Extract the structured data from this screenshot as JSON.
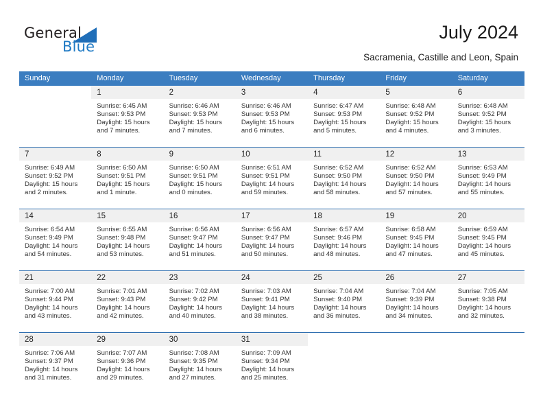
{
  "brand": {
    "name_part1": "General",
    "name_part2": "Blue",
    "accent_color": "#1f7ac4",
    "logo_icon": "triangle-flag-icon"
  },
  "header": {
    "title": "July 2024",
    "subtitle": "Sacramenia, Castille and Leon, Spain"
  },
  "calendar": {
    "header_bg": "#3b7dc0",
    "date_band_bg": "#f0f0f0",
    "row_border_color": "#2f6fb0",
    "weekdays": [
      "Sunday",
      "Monday",
      "Tuesday",
      "Wednesday",
      "Thursday",
      "Friday",
      "Saturday"
    ],
    "weeks": [
      [
        {
          "day": "",
          "lines": []
        },
        {
          "day": "1",
          "lines": [
            "Sunrise: 6:45 AM",
            "Sunset: 9:53 PM",
            "Daylight: 15 hours",
            "and 7 minutes."
          ]
        },
        {
          "day": "2",
          "lines": [
            "Sunrise: 6:46 AM",
            "Sunset: 9:53 PM",
            "Daylight: 15 hours",
            "and 7 minutes."
          ]
        },
        {
          "day": "3",
          "lines": [
            "Sunrise: 6:46 AM",
            "Sunset: 9:53 PM",
            "Daylight: 15 hours",
            "and 6 minutes."
          ]
        },
        {
          "day": "4",
          "lines": [
            "Sunrise: 6:47 AM",
            "Sunset: 9:53 PM",
            "Daylight: 15 hours",
            "and 5 minutes."
          ]
        },
        {
          "day": "5",
          "lines": [
            "Sunrise: 6:48 AM",
            "Sunset: 9:52 PM",
            "Daylight: 15 hours",
            "and 4 minutes."
          ]
        },
        {
          "day": "6",
          "lines": [
            "Sunrise: 6:48 AM",
            "Sunset: 9:52 PM",
            "Daylight: 15 hours",
            "and 3 minutes."
          ]
        }
      ],
      [
        {
          "day": "7",
          "lines": [
            "Sunrise: 6:49 AM",
            "Sunset: 9:52 PM",
            "Daylight: 15 hours",
            "and 2 minutes."
          ]
        },
        {
          "day": "8",
          "lines": [
            "Sunrise: 6:50 AM",
            "Sunset: 9:51 PM",
            "Daylight: 15 hours",
            "and 1 minute."
          ]
        },
        {
          "day": "9",
          "lines": [
            "Sunrise: 6:50 AM",
            "Sunset: 9:51 PM",
            "Daylight: 15 hours",
            "and 0 minutes."
          ]
        },
        {
          "day": "10",
          "lines": [
            "Sunrise: 6:51 AM",
            "Sunset: 9:51 PM",
            "Daylight: 14 hours",
            "and 59 minutes."
          ]
        },
        {
          "day": "11",
          "lines": [
            "Sunrise: 6:52 AM",
            "Sunset: 9:50 PM",
            "Daylight: 14 hours",
            "and 58 minutes."
          ]
        },
        {
          "day": "12",
          "lines": [
            "Sunrise: 6:52 AM",
            "Sunset: 9:50 PM",
            "Daylight: 14 hours",
            "and 57 minutes."
          ]
        },
        {
          "day": "13",
          "lines": [
            "Sunrise: 6:53 AM",
            "Sunset: 9:49 PM",
            "Daylight: 14 hours",
            "and 55 minutes."
          ]
        }
      ],
      [
        {
          "day": "14",
          "lines": [
            "Sunrise: 6:54 AM",
            "Sunset: 9:49 PM",
            "Daylight: 14 hours",
            "and 54 minutes."
          ]
        },
        {
          "day": "15",
          "lines": [
            "Sunrise: 6:55 AM",
            "Sunset: 9:48 PM",
            "Daylight: 14 hours",
            "and 53 minutes."
          ]
        },
        {
          "day": "16",
          "lines": [
            "Sunrise: 6:56 AM",
            "Sunset: 9:47 PM",
            "Daylight: 14 hours",
            "and 51 minutes."
          ]
        },
        {
          "day": "17",
          "lines": [
            "Sunrise: 6:56 AM",
            "Sunset: 9:47 PM",
            "Daylight: 14 hours",
            "and 50 minutes."
          ]
        },
        {
          "day": "18",
          "lines": [
            "Sunrise: 6:57 AM",
            "Sunset: 9:46 PM",
            "Daylight: 14 hours",
            "and 48 minutes."
          ]
        },
        {
          "day": "19",
          "lines": [
            "Sunrise: 6:58 AM",
            "Sunset: 9:45 PM",
            "Daylight: 14 hours",
            "and 47 minutes."
          ]
        },
        {
          "day": "20",
          "lines": [
            "Sunrise: 6:59 AM",
            "Sunset: 9:45 PM",
            "Daylight: 14 hours",
            "and 45 minutes."
          ]
        }
      ],
      [
        {
          "day": "21",
          "lines": [
            "Sunrise: 7:00 AM",
            "Sunset: 9:44 PM",
            "Daylight: 14 hours",
            "and 43 minutes."
          ]
        },
        {
          "day": "22",
          "lines": [
            "Sunrise: 7:01 AM",
            "Sunset: 9:43 PM",
            "Daylight: 14 hours",
            "and 42 minutes."
          ]
        },
        {
          "day": "23",
          "lines": [
            "Sunrise: 7:02 AM",
            "Sunset: 9:42 PM",
            "Daylight: 14 hours",
            "and 40 minutes."
          ]
        },
        {
          "day": "24",
          "lines": [
            "Sunrise: 7:03 AM",
            "Sunset: 9:41 PM",
            "Daylight: 14 hours",
            "and 38 minutes."
          ]
        },
        {
          "day": "25",
          "lines": [
            "Sunrise: 7:04 AM",
            "Sunset: 9:40 PM",
            "Daylight: 14 hours",
            "and 36 minutes."
          ]
        },
        {
          "day": "26",
          "lines": [
            "Sunrise: 7:04 AM",
            "Sunset: 9:39 PM",
            "Daylight: 14 hours",
            "and 34 minutes."
          ]
        },
        {
          "day": "27",
          "lines": [
            "Sunrise: 7:05 AM",
            "Sunset: 9:38 PM",
            "Daylight: 14 hours",
            "and 32 minutes."
          ]
        }
      ],
      [
        {
          "day": "28",
          "lines": [
            "Sunrise: 7:06 AM",
            "Sunset: 9:37 PM",
            "Daylight: 14 hours",
            "and 31 minutes."
          ]
        },
        {
          "day": "29",
          "lines": [
            "Sunrise: 7:07 AM",
            "Sunset: 9:36 PM",
            "Daylight: 14 hours",
            "and 29 minutes."
          ]
        },
        {
          "day": "30",
          "lines": [
            "Sunrise: 7:08 AM",
            "Sunset: 9:35 PM",
            "Daylight: 14 hours",
            "and 27 minutes."
          ]
        },
        {
          "day": "31",
          "lines": [
            "Sunrise: 7:09 AM",
            "Sunset: 9:34 PM",
            "Daylight: 14 hours",
            "and 25 minutes."
          ]
        },
        {
          "day": "",
          "lines": []
        },
        {
          "day": "",
          "lines": []
        },
        {
          "day": "",
          "lines": []
        }
      ]
    ]
  }
}
